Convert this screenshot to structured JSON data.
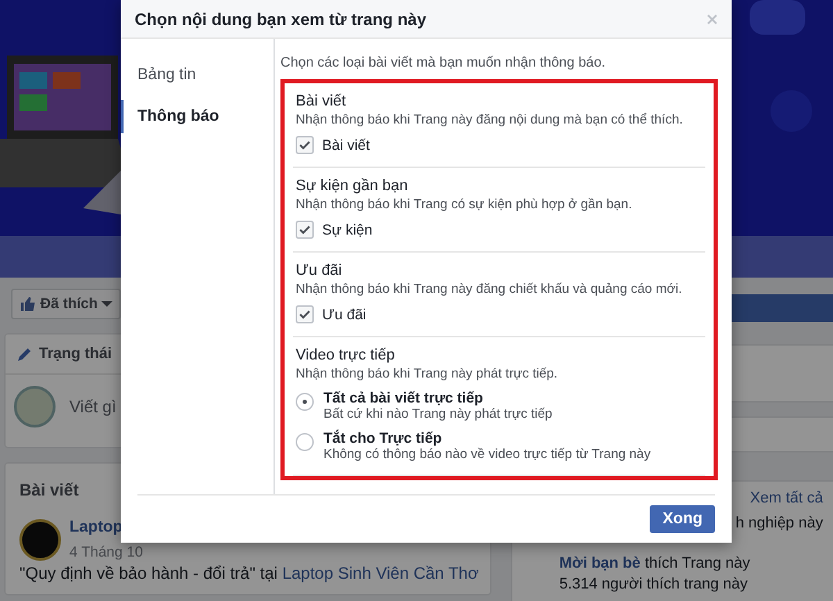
{
  "background": {
    "like_button": "Đã thích",
    "status_tab": "Trạng thái",
    "composer_placeholder": "Viết gì",
    "posts_heading": "Bài viết",
    "post": {
      "author": "Laptop",
      "date": "4 Tháng 10",
      "quote": "\"Quy định về bảo hành - đổi trả\" tại ",
      "link": "Laptop Sinh Viên Cần Thơ"
    },
    "sidebar": {
      "see_all": "Xem tất cả",
      "line_1": "h nghiệp này",
      "invite_link": "Mời bạn bè",
      "invite_text": "thích Trang này",
      "likes": "5.314 người thích trang này"
    }
  },
  "dialog": {
    "title": "Chọn nội dung bạn xem từ trang này",
    "nav": [
      {
        "label": "Bảng tin",
        "selected": false
      },
      {
        "label": "Thông báo",
        "selected": true
      }
    ],
    "intro": "Chọn các loại bài viết mà bạn muốn nhận thông báo.",
    "sections": [
      {
        "kind": "checkbox",
        "title": "Bài viết",
        "description": "Nhận thông báo khi Trang này đăng nội dung mà bạn có thể thích.",
        "options": [
          {
            "label": "Bài viết",
            "checked": true
          }
        ]
      },
      {
        "kind": "checkbox",
        "title": "Sự kiện gần bạn",
        "description": "Nhận thông báo khi Trang có sự kiện phù hợp ở gần bạn.",
        "options": [
          {
            "label": "Sự kiện",
            "checked": true
          }
        ]
      },
      {
        "kind": "checkbox",
        "title": "Ưu đãi",
        "description": "Nhận thông báo khi Trang này đăng chiết khấu và quảng cáo mới.",
        "options": [
          {
            "label": "Ưu đãi",
            "checked": true
          }
        ]
      },
      {
        "kind": "radio",
        "title": "Video trực tiếp",
        "description": "Nhận thông báo khi Trang này phát trực tiếp.",
        "options": [
          {
            "label": "Tất cả bài viết trực tiếp",
            "description": "Bất cứ khi nào Trang này phát trực tiếp",
            "selected": true
          },
          {
            "label": "Tắt cho Trực tiếp",
            "description": "Không có thông báo nào về video trực tiếp từ Trang này",
            "selected": false
          }
        ]
      }
    ],
    "done_button": "Xong"
  }
}
